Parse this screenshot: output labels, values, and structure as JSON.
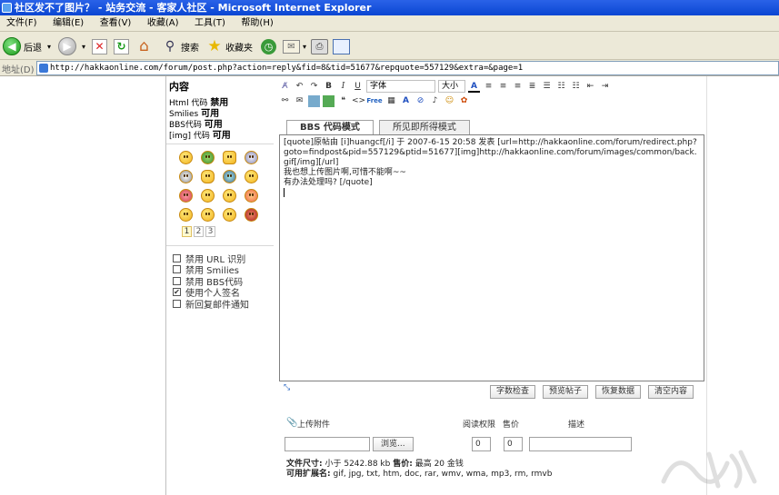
{
  "window": {
    "title": "社区发不了图片？ - 站务交流 - 客家人社区 - Microsoft Internet Explorer"
  },
  "menu": [
    "文件(F)",
    "编辑(E)",
    "查看(V)",
    "收藏(A)",
    "工具(T)",
    "帮助(H)"
  ],
  "toolbar": {
    "back": "后退",
    "search": "搜索",
    "favorites": "收藏夹"
  },
  "address": {
    "label": "地址(D)",
    "url": "http://hakkaonline.com/forum/post.php?action=reply&fid=8&tid=51677&repquote=557129&extra=&page=1"
  },
  "sidebar": {
    "title": "内容",
    "options": [
      {
        "name": "Html 代码",
        "state": "禁用"
      },
      {
        "name": "Smilies",
        "state": "可用"
      },
      {
        "name": "BBS代码",
        "state": "可用"
      },
      {
        "name": "[img] 代码",
        "state": "可用"
      }
    ],
    "pages": [
      "1",
      "2",
      "3"
    ],
    "checkboxes": [
      {
        "label": "禁用 URL 识别",
        "checked": false
      },
      {
        "label": "禁用 Smilies",
        "checked": false
      },
      {
        "label": "禁用 BBS代码",
        "checked": false
      },
      {
        "label": "使用个人签名",
        "checked": true
      },
      {
        "label": "新回复邮件通知",
        "checked": false
      }
    ]
  },
  "editor": {
    "font_select": "字体",
    "size_select": "大小",
    "tabs": {
      "bbcode": "BBS 代码模式",
      "wysiwyg": "所见即所得模式"
    },
    "content": "[quote]原帖由 [i]huangcf[/i] 于 2007-6-15 20:58 发表 [url=http://hakkaonline.com/forum/redirect.php?goto=findpost&pid=557129&ptid=51677][img]http://hakkaonline.com/forum/images/common/back.gif[/img][/url]\n我也想上传图片啊,可惜不能啊~~\n有办法处理吗? [/quote]",
    "buttons": [
      "字数检查",
      "预览帖子",
      "恢复数据",
      "清空内容"
    ]
  },
  "attachment": {
    "label": "上传附件",
    "browse": "浏览...",
    "perm_label": "阅读权限",
    "price_label": "售价",
    "desc_label": "描述",
    "perm_value": "0",
    "price_value": "0"
  },
  "info": {
    "size_label": "文件尺寸:",
    "size_text": "小于 5242.88 kb",
    "price_label": "售价:",
    "price_text": "最高 20 金钱",
    "ext_label": "可用扩展名:",
    "ext_text": "gif, jpg, txt, htm, doc, rar, wmv, wma, mp3, rm, rmvb"
  },
  "colors": {
    "titlebar": "#0a46d2",
    "chrome": "#ece9d8"
  }
}
